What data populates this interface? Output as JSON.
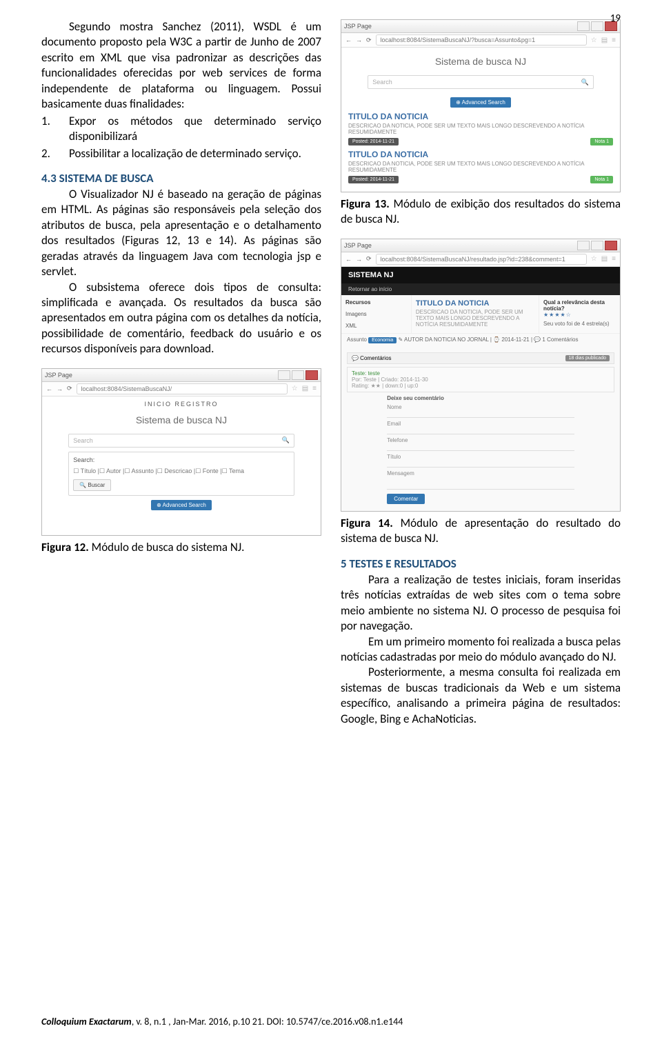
{
  "page_number": "19",
  "left_col": {
    "para1": "Segundo mostra Sanchez (2011), WSDL é um documento proposto pela W3C a partir de Junho de 2007 escrito em XML que visa padronizar as descrições das funcionalidades oferecidas por web services de forma independente de plataforma ou linguagem. Possui basicamente duas finalidades:",
    "item1_num": "1.",
    "item1_text": "Expor os métodos que determinado serviço disponibilizará",
    "item2_num": "2.",
    "item2_text": "Possibilitar a localização de determinado serviço.",
    "section43_head": "4.3 SISTEMA DE BUSCA",
    "section43_para1": "O Visualizador NJ é baseado na geração de páginas em HTML. As páginas são responsáveis pela seleção dos atributos de busca, pela apresentação e o detalhamento dos resultados (Figuras 12, 13 e 14). As páginas são geradas através da linguagem Java com tecnologia jsp e servlet.",
    "section43_para2": "O subsistema oferece dois tipos de consulta: simplificada e avançada. Os resultados da busca são apresentados em outra página com os detalhes da notícia, possibilidade de comentário, feedback do usuário e os recursos disponíveis para download.",
    "fig12_caption_bold": "Figura 12.",
    "fig12_caption_rest": " Módulo de busca do sistema NJ."
  },
  "right_col": {
    "fig13_caption_bold": "Figura 13.",
    "fig13_caption_rest": " Módulo de exibição dos resultados do sistema de busca NJ.",
    "fig14_caption_bold": "Figura 14.",
    "fig14_caption_rest": " Módulo de apresentação do resultado do sistema de busca NJ.",
    "section5_head": "5 TESTES E RESULTADOS",
    "section5_para1": "Para a realização de testes iniciais, foram inseridas três notícias extraídas de web sites com o tema sobre meio ambiente no sistema NJ. O processo de pesquisa foi por navegação.",
    "section5_para2": "Em um primeiro momento foi realizada a busca pelas notícias cadastradas por meio do módulo avançado do NJ.",
    "section5_para3": "Posteriormente, a mesma consulta foi realizada em sistemas de buscas tradicionais da Web e um sistema específico, analisando a primeira página de resultados: Google, Bing e AchaNoticias."
  },
  "fig12": {
    "tab": "JSP Page",
    "url": "localhost:8084/SistemaBuscaNJ/",
    "nav": "INICIO   REGISTRO",
    "title": "Sistema de busca NJ",
    "search_placeholder": "Search",
    "adv_label": "Search:",
    "adv_opts": "☐ Título  |☐  Autor  |☐  Assunto  |☐  Descricao  |☐  Fonte  |☐  Tema",
    "btn_buscar": "🔍 Buscar",
    "btn_adv": "⊕ Advanced Search"
  },
  "fig13": {
    "tab": "JSP Page",
    "url": "localhost:8084/SistemaBuscaNJ/?busca=Assunto&pg=1",
    "title": "Sistema de busca NJ",
    "search_placeholder": "Search",
    "btn_adv": "⊕ Advanced Search",
    "card_title": "TITULO DA NOTICIA",
    "card_desc": "DESCRICAO DA NOTICIA, PODE SER UM TEXTO MAIS LONGO DESCREVENDO A NOTÍCIA RESUMIDAMENTE",
    "posted": "Posted: 2014-11-21",
    "pill": "Nota 1"
  },
  "fig14": {
    "tab": "JSP Page",
    "url": "localhost:8084/SistemaBuscaNJ/resultado.jsp?id=238&comment=1",
    "brand": "SISTEMA NJ",
    "back": "Retornar ao início",
    "left_head": "Recursos",
    "left_items": [
      "Imagens",
      "XML"
    ],
    "mid_title": "TITULO DA NOTICIA",
    "mid_desc": "DESCRICAO DA NOTICIA, PODE SER UM TEXTO MAIS LONGO DESCREVENDO A NOTÍCIA RESUMIDAMENTE",
    "right_q": "Qual a relevância desta notícia?",
    "right_vote": "Seu voto foi de 4 estrela(s)",
    "assunto_label": "Assunto",
    "assunto_tag": "Economia",
    "meta_rest": " ✎ AUTOR DA NOTICIA NO JORNAL | ⌚ 2014-11-21 | 💬 1 Comentários",
    "comments_head": "💬 Comentários",
    "comments_time": "18 dias publicado",
    "comment_user": "Teste: teste",
    "comment_date": "Por: Teste | Criado: 2014-11-30",
    "comment_rating": "Rating: ★★ | down:0 | up:0",
    "form_title": "Deixe seu comentário",
    "f_nome": "Nome",
    "f_email": "Email",
    "f_telefone": "Telefone",
    "f_titulo": "Título",
    "f_msg": "Mensagem",
    "btn_comentar": "Comentar"
  },
  "footer": {
    "journal_italic": "Colloquium Exactarum",
    "rest": ", v. 8, n.1 , Jan-Mar. 2016, p.10  21. DOI: 10.5747/ce.2016.v08.n1.e144"
  }
}
